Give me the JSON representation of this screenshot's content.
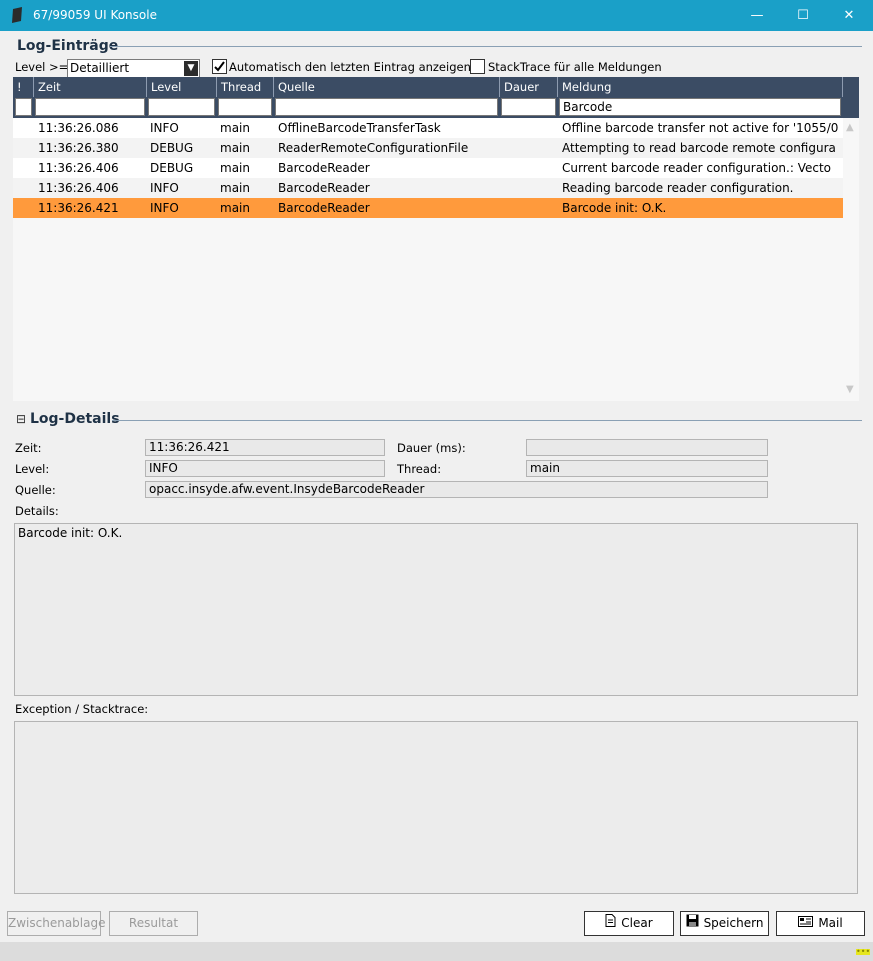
{
  "window": {
    "title": "67/99059 UI Konsole",
    "minimize_glyph": "—",
    "maximize_glyph": "☐",
    "close_glyph": "✕"
  },
  "log_entries": {
    "header": "Log-Einträge",
    "level_label": "Level >=",
    "level_value": "Detailliert",
    "auto_scroll_label": "Automatisch den letzten Eintrag anzeigen",
    "auto_scroll_checked": true,
    "stacktrace_label": "StackTrace für alle Meldungen",
    "stacktrace_checked": false,
    "columns": [
      "!",
      "Zeit",
      "Level",
      "Thread",
      "Quelle",
      "Dauer",
      "Meldung"
    ],
    "filters": [
      "",
      "",
      "",
      "",
      "",
      "",
      "Barcode"
    ],
    "rows": [
      {
        "flag": "",
        "zeit": "11:36:26.086",
        "level": "INFO",
        "thread": "main",
        "quelle": "OfflineBarcodeTransferTask",
        "dauer": "",
        "meldung": "Offline barcode transfer not active for '1055/0"
      },
      {
        "flag": "",
        "zeit": "11:36:26.380",
        "level": "DEBUG",
        "thread": "main",
        "quelle": "ReaderRemoteConfigurationFile",
        "dauer": "",
        "meldung": "Attempting to read barcode remote configura"
      },
      {
        "flag": "",
        "zeit": "11:36:26.406",
        "level": "DEBUG",
        "thread": "main",
        "quelle": "BarcodeReader",
        "dauer": "",
        "meldung": "Current barcode reader configuration.: Vecto"
      },
      {
        "flag": "",
        "zeit": "11:36:26.406",
        "level": "INFO",
        "thread": "main",
        "quelle": "BarcodeReader",
        "dauer": "",
        "meldung": "Reading barcode reader configuration."
      },
      {
        "flag": "",
        "zeit": "11:36:26.421",
        "level": "INFO",
        "thread": "main",
        "quelle": "BarcodeReader",
        "dauer": "",
        "meldung": "Barcode init: O.K."
      }
    ],
    "selected_row": 4
  },
  "log_details": {
    "collapse_glyph": "⊟",
    "header": "Log-Details",
    "zeit_label": "Zeit:",
    "zeit_value": "11:36:26.421",
    "dauer_label": "Dauer (ms):",
    "dauer_value": "",
    "level_label": "Level:",
    "level_value": "INFO",
    "thread_label": "Thread:",
    "thread_value": "main",
    "quelle_label": "Quelle:",
    "quelle_value": "opacc.insyde.afw.event.InsydeBarcodeReader",
    "details_label": "Details:",
    "details_value": "Barcode init: O.K.",
    "exception_label": "Exception / Stacktrace:",
    "exception_value": ""
  },
  "buttons": {
    "clipboard": "Zwischenablage",
    "result": "Resultat",
    "clear": "Clear",
    "save": "Speichern",
    "mail": "Mail"
  },
  "colors": {
    "titlebar": "#1aa0c8",
    "grid_header": "#3b4c64",
    "selected_row": "#ff9a3c"
  }
}
